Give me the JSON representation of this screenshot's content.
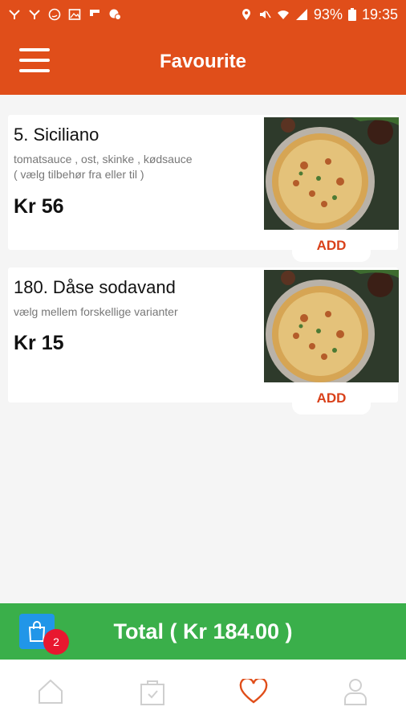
{
  "status_bar": {
    "battery": "93%",
    "time": "19:35"
  },
  "header": {
    "title": "Favourite"
  },
  "items": [
    {
      "name": "5. Siciliano",
      "desc_line1": "tomatsauce , ost,  skinke , kødsauce",
      "desc_line2": "( vælg tilbehør fra eller til )",
      "price": "Kr 56",
      "add_label": "ADD"
    },
    {
      "name": "180. Dåse sodavand",
      "desc_line1": "vælg mellem forskellige varianter",
      "desc_line2": "",
      "price": "Kr 15",
      "add_label": "ADD"
    }
  ],
  "cart": {
    "badge_count": "2",
    "total_label": "Total ( Kr 184.00 )"
  },
  "bottom_nav": {
    "items": [
      "home-icon",
      "orders-icon",
      "heart-icon",
      "profile-icon"
    ],
    "active": "heart-icon"
  },
  "colors": {
    "brand": "#e04e1a",
    "total_bar": "#3aaf4a",
    "cart_button": "#2196e8",
    "badge": "#e8172f",
    "add_text": "#d9411a"
  }
}
